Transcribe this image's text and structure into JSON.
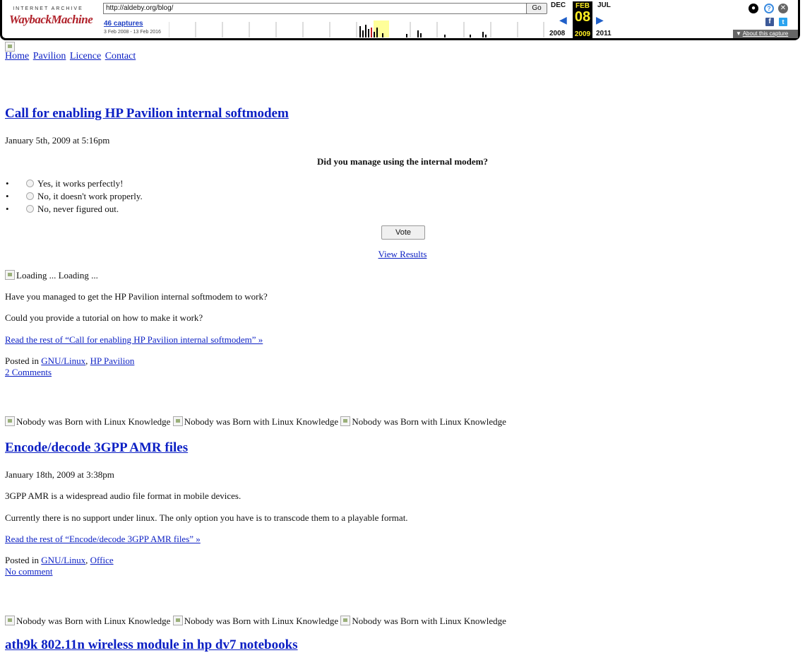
{
  "wayback": {
    "logo_top": "INTERNET ARCHIVE",
    "logo_main": "WaybackMachine",
    "url": "http://aldeby.org/blog/",
    "go": "Go",
    "captures": "46 captures",
    "range": "3 Feb 2008 - 13 Feb 2016",
    "prev_month": "DEC",
    "cur_month": "FEB",
    "next_month": "JUL",
    "cur_day": "08",
    "prev_year": "2008",
    "cur_year": "2009",
    "next_year": "2011",
    "about": "About this capture",
    "sparkline": [
      0,
      0,
      0,
      0,
      0,
      0,
      0,
      0,
      0,
      0,
      0,
      0,
      0,
      0,
      0,
      0,
      0,
      0,
      0,
      0,
      0,
      0,
      0,
      0,
      0,
      0,
      0,
      0,
      0,
      0,
      0,
      0,
      0,
      0,
      0,
      0,
      0,
      0,
      0,
      0,
      0,
      0,
      0,
      0,
      0,
      0,
      0,
      0,
      0,
      0,
      0,
      0,
      0,
      0,
      0,
      0,
      0,
      0,
      0,
      0,
      0,
      0,
      0,
      0,
      0,
      0,
      0,
      0,
      0,
      0,
      0,
      0,
      0,
      0,
      0,
      0,
      0,
      0,
      0,
      0,
      0,
      0,
      0,
      0,
      0,
      0,
      0,
      0,
      0,
      0,
      0,
      0,
      0,
      0,
      0,
      0,
      0,
      0,
      0,
      0,
      0,
      0,
      0,
      0,
      0,
      0,
      0,
      0,
      0,
      0,
      0,
      0,
      0,
      0,
      0,
      0,
      0,
      0,
      0,
      0,
      0,
      0,
      0,
      0,
      0,
      0,
      0,
      0,
      0,
      0,
      0,
      0,
      0,
      0,
      0,
      0,
      0,
      0,
      0,
      0,
      0,
      0,
      0,
      0,
      0,
      0,
      0,
      0,
      0,
      0,
      0,
      0,
      0,
      0,
      0,
      0,
      0,
      0,
      0,
      0,
      0,
      0,
      0,
      0,
      0,
      0,
      0,
      0,
      0,
      0,
      0,
      0,
      0,
      0,
      0,
      0,
      0,
      0,
      0,
      0,
      0,
      0,
      0,
      0,
      0,
      0,
      0,
      0,
      0,
      0,
      0,
      0,
      0,
      0,
      0,
      0,
      0,
      0,
      0,
      0,
      0,
      0,
      0,
      0,
      0,
      0,
      0,
      0,
      0,
      0,
      0,
      0,
      0,
      0,
      0,
      0,
      0,
      0,
      0,
      0,
      0,
      0,
      0,
      0,
      0,
      0,
      0,
      0,
      0,
      0,
      0,
      0,
      0,
      0,
      0,
      0,
      0,
      0,
      0,
      0,
      0,
      0,
      0,
      0,
      0,
      0,
      0,
      0,
      0,
      0,
      0,
      0,
      0,
      0,
      0,
      0,
      0,
      0,
      0,
      0,
      0,
      0,
      0,
      0,
      0,
      0,
      0,
      0,
      0,
      0,
      0,
      0,
      0,
      0,
      0,
      0,
      0,
      0,
      0,
      0,
      0,
      0,
      0,
      0,
      0,
      0,
      0,
      0,
      0,
      0,
      0,
      0,
      0,
      0,
      0,
      0,
      0,
      0,
      0,
      0,
      0,
      0,
      0,
      0,
      0,
      0,
      0,
      0,
      0,
      0,
      0,
      0,
      0,
      0,
      0,
      0,
      0,
      0,
      0,
      0,
      0,
      0,
      0,
      0,
      0,
      0,
      0,
      0,
      0,
      0,
      0,
      0,
      0,
      0,
      0,
      0,
      0,
      0,
      0,
      0,
      0,
      0,
      0,
      0,
      0,
      0,
      0,
      0,
      0,
      0,
      0,
      0,
      0,
      0,
      0,
      0,
      0,
      0,
      0,
      0,
      0,
      0,
      0,
      0,
      0,
      0,
      0,
      0,
      0,
      0,
      0,
      0,
      0,
      0,
      0,
      0,
      0,
      0,
      0,
      0,
      0,
      0,
      0,
      0,
      0,
      0,
      0,
      0,
      0,
      0,
      0,
      0,
      0,
      0,
      0,
      0,
      0,
      0,
      0,
      0,
      0,
      0,
      0,
      0,
      0,
      0,
      0,
      0,
      0,
      0,
      0,
      0,
      0,
      0,
      0,
      0,
      0,
      0,
      0,
      0,
      0,
      0,
      0,
      0,
      0,
      0,
      0,
      0,
      0,
      0,
      0,
      0,
      0,
      0,
      0,
      0,
      0,
      0,
      0,
      0,
      0,
      0,
      0,
      0,
      0,
      0,
      0,
      0,
      0,
      0,
      0,
      0,
      0,
      0,
      0,
      0,
      0,
      0,
      0,
      0,
      0,
      0,
      0,
      0,
      0,
      0,
      0,
      0,
      0,
      0,
      0,
      0,
      0,
      0,
      0,
      0,
      0,
      0,
      0,
      0,
      0,
      0,
      0,
      0,
      0,
      0,
      0,
      0,
      0,
      0,
      0,
      0,
      0,
      0,
      0,
      0,
      0,
      0,
      0,
      0,
      0,
      0,
      0,
      0,
      0,
      0,
      0,
      0,
      0,
      0,
      0,
      0,
      0,
      0,
      0,
      0,
      0,
      0,
      0,
      0,
      0,
      0,
      0,
      0,
      0,
      0,
      0,
      0,
      0,
      0,
      0,
      0,
      0,
      0,
      0,
      0,
      0,
      0,
      0,
      0,
      0,
      0,
      0,
      0,
      0,
      0,
      0
    ]
  },
  "nav": {
    "home": "Home",
    "pavilion": "Pavilion",
    "licence": "Licence",
    "contact": "Contact"
  },
  "post1": {
    "title": "Call for enabling HP Pavilion internal softmodem",
    "date": "January 5th, 2009 at 5:16pm",
    "poll_question": "Did you manage using the internal modem?",
    "options": [
      "Yes, it works perfectly!",
      "No, it doesn't work properly.",
      "No, never figured out."
    ],
    "vote": "Vote",
    "view_results": "View Results",
    "loading_alt": "Loading",
    "loading": " ... Loading ...",
    "p1": "Have you managed to get the HP Pavilion internal softmodem to work?",
    "p2": "Could you provide a tutorial on how to make it work?",
    "read_more": "Read the rest of “Call for enabling HP Pavilion internal softmodem” »",
    "posted_in": "Posted in ",
    "cat1": "GNU/Linux",
    "sep": ", ",
    "cat2": "HP Pavilion",
    "comments": "2 Comments"
  },
  "banner": {
    "alt": "Nobody was Born with Linux Knowledge"
  },
  "post2": {
    "title": "Encode/decode 3GPP AMR files",
    "date": "January 18th, 2009 at 3:38pm",
    "p1": "3GPP AMR is a widespread audio file format in mobile devices.",
    "p2": "Currently there is no support under linux. The only option you have is to transcode them to a playable format.",
    "read_more": "Read the rest of “Encode/decode 3GPP AMR files” »",
    "posted_in": "Posted in ",
    "cat1": "GNU/Linux",
    "sep": ", ",
    "cat2": "Office",
    "comments": "No comment"
  },
  "post3": {
    "title": "ath9k 802.11n wireless module in hp dv7 notebooks"
  }
}
